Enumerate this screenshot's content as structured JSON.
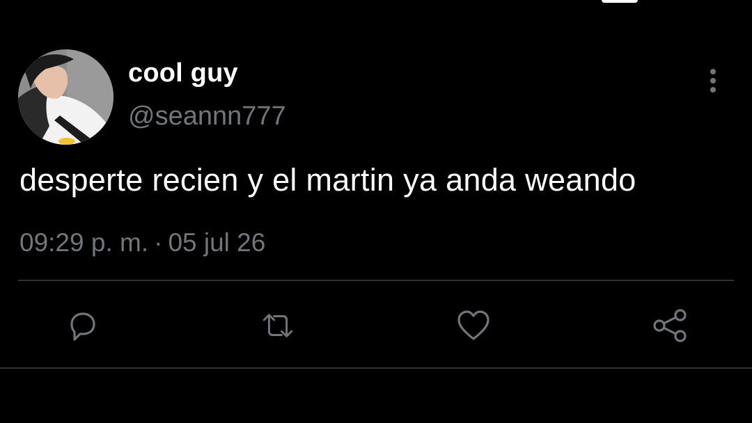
{
  "tweet": {
    "author": {
      "display_name": "cool guy",
      "handle": "@seannn777",
      "avatar_icon": "profile-photo"
    },
    "text": "desperte recien y el martin ya anda weando",
    "time": "09:29 p. m.",
    "separator": "·",
    "date": "05 jul 26"
  },
  "actions": {
    "reply_icon": "comment-icon",
    "retweet_icon": "retweet-icon",
    "like_icon": "heart-icon",
    "share_icon": "share-icon",
    "more_icon": "vertical-dots-icon"
  },
  "colors": {
    "background": "#000000",
    "primary_text": "#ffffff",
    "secondary_text": "#71767b",
    "divider": "#2f3336",
    "icon": "#71767b"
  }
}
